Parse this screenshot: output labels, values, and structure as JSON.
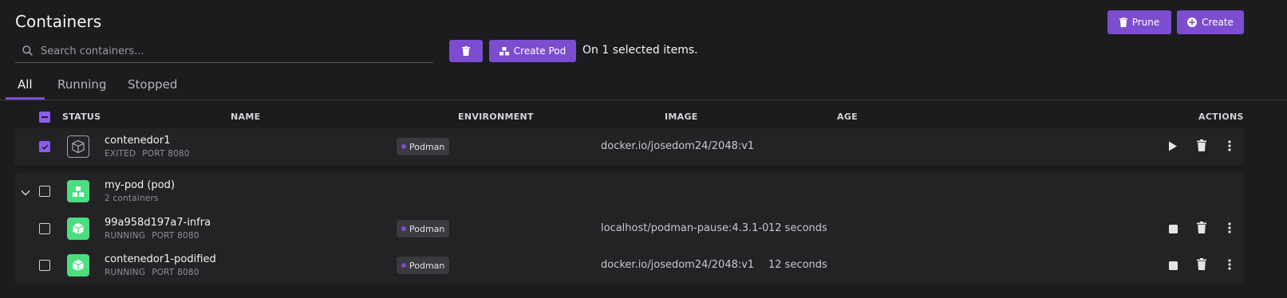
{
  "page": {
    "title": "Containers"
  },
  "toolbar": {
    "prune_label": "Prune",
    "create_label": "Create"
  },
  "search": {
    "placeholder": "Search containers..."
  },
  "bulk": {
    "create_pod_label": "Create Pod",
    "selected_text": "On 1 selected items."
  },
  "tabs": [
    {
      "label": "All",
      "active": true
    },
    {
      "label": "Running"
    },
    {
      "label": "Stopped"
    }
  ],
  "table": {
    "headers": {
      "status": "STATUS",
      "name": "NAME",
      "environment": "ENVIRONMENT",
      "image": "IMAGE",
      "age": "AGE",
      "actions": "ACTIONS"
    },
    "rows": [
      {
        "name": "contenedor1",
        "state": "EXITED",
        "port": "PORT 8080",
        "environment": "Podman",
        "image": "docker.io/josedom24/2048:v1",
        "age": "",
        "selected": true
      },
      {
        "name": "my-pod (pod)",
        "subtitle": "2 containers",
        "expanded": true,
        "selected": false
      },
      {
        "name": "99a958d197a7-infra",
        "state": "RUNNING",
        "port": "PORT 8080",
        "environment": "Podman",
        "image": "localhost/podman-pause:4.3.1-0",
        "age": "12 seconds",
        "selected": false
      },
      {
        "name": "contenedor1-podified",
        "state": "RUNNING",
        "port": "PORT 8080",
        "environment": "Podman",
        "image": "docker.io/josedom24/2048:v1",
        "age": "12 seconds",
        "selected": false
      }
    ]
  },
  "colors": {
    "accent": "#7c4dce",
    "running": "#4ade80",
    "background": "#1c1c1e",
    "card": "#232326"
  }
}
